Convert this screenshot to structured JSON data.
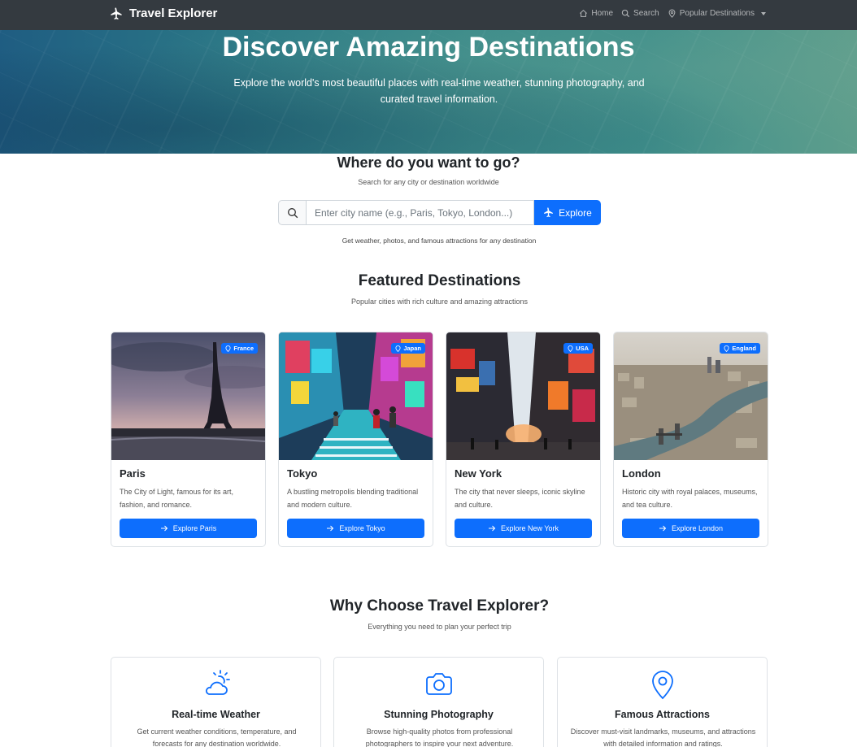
{
  "navbar": {
    "brand": "Travel Explorer",
    "links": [
      {
        "label": "Home",
        "icon": "house-icon"
      },
      {
        "label": "Search",
        "icon": "search-icon"
      },
      {
        "label": "Popular Destinations",
        "icon": "geo-pin-icon"
      }
    ]
  },
  "hero": {
    "title": "Discover Amazing Destinations",
    "subtitle": "Explore the world's most beautiful places with real-time weather, stunning photography, and curated travel information."
  },
  "search": {
    "title": "Where do you want to go?",
    "subtitle": "Search for any city or destination worldwide",
    "placeholder": "Enter city name (e.g., Paris, Tokyo, London...)",
    "button_label": "Explore",
    "help_text": "Get weather, photos, and famous attractions for any destination"
  },
  "featured": {
    "title": "Featured Destinations",
    "subtitle": "Popular cities with rich culture and amazing attractions",
    "cards": [
      {
        "name": "Paris",
        "country": "France",
        "description": "The City of Light, famous for its art, fashion, and romance.",
        "button": "Explore Paris"
      },
      {
        "name": "Tokyo",
        "country": "Japan",
        "description": "A bustling metropolis blending traditional and modern culture.",
        "button": "Explore Tokyo"
      },
      {
        "name": "New York",
        "country": "USA",
        "description": "The city that never sleeps, iconic skyline and culture.",
        "button": "Explore New York"
      },
      {
        "name": "London",
        "country": "England",
        "description": "Historic city with royal palaces, museums, and tea culture.",
        "button": "Explore London"
      }
    ]
  },
  "why": {
    "title": "Why Choose Travel Explorer?",
    "subtitle": "Everything you need to plan your perfect trip",
    "features": [
      {
        "title": "Real-time Weather",
        "description": "Get current weather conditions, temperature, and forecasts for any destination worldwide.",
        "icon": "cloud-sun-icon"
      },
      {
        "title": "Stunning Photography",
        "description": "Browse high-quality photos from professional photographers to inspire your next adventure.",
        "icon": "camera-icon"
      },
      {
        "title": "Famous Attractions",
        "description": "Discover must-visit landmarks, museums, and attractions with detailed information and ratings.",
        "icon": "geo-pin-icon"
      }
    ]
  },
  "colors": {
    "navbar": "#343a40",
    "primary": "#0d6efd",
    "hero_start": "#1f5d82",
    "hero_end": "#5e9e8c"
  }
}
